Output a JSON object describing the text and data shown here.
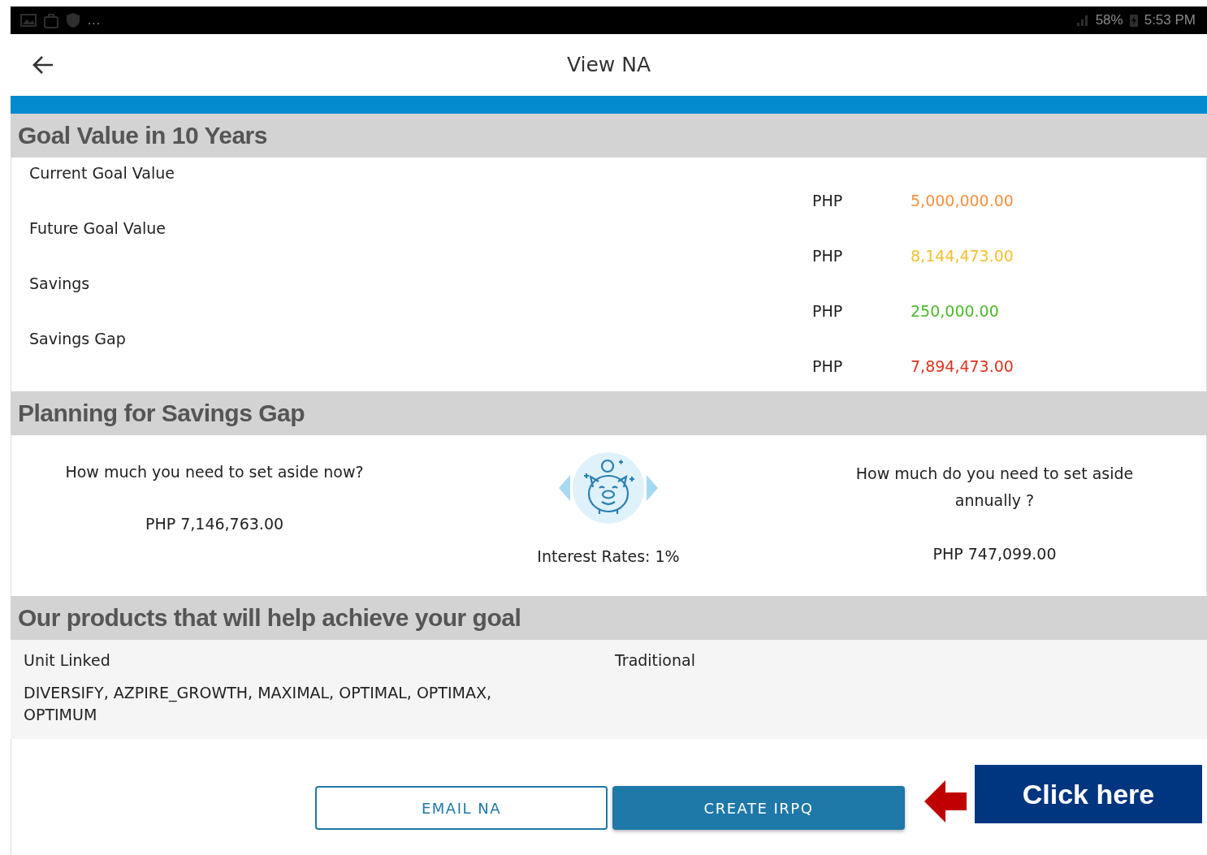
{
  "status_bar": {
    "overflow": "…",
    "battery": "58%",
    "time": "5:53 PM"
  },
  "header": {
    "title": "View NA"
  },
  "goal_section": {
    "title": "Goal Value in 10 Years",
    "rows": [
      {
        "label": "Current Goal Value",
        "currency": "PHP",
        "value": "5,000,000.00",
        "color": "#f7903f"
      },
      {
        "label": "Future Goal Value",
        "currency": "PHP",
        "value": "8,144,473.00",
        "color": "#f2c12e"
      },
      {
        "label": "Savings",
        "currency": "PHP",
        "value": "250,000.00",
        "color": "#4cb82a"
      },
      {
        "label": "Savings Gap",
        "currency": "PHP",
        "value": "7,894,473.00",
        "color": "#e0321e"
      }
    ]
  },
  "planning_section": {
    "title": "Planning for Savings Gap",
    "now_question": "How much you need to set aside now?",
    "now_amount": "PHP 7,146,763.00",
    "interest": "Interest Rates: 1%",
    "annual_question": "How much do you need to set aside annually ?",
    "annual_amount": "PHP 747,099.00"
  },
  "products_section": {
    "title": "Our products that will help achieve your goal",
    "columns": [
      {
        "heading": "Unit Linked",
        "products": "DIVERSIFY, AZPIRE_GROWTH, MAXIMAL, OPTIMAL, OPTIMAX, OPTIMUM"
      },
      {
        "heading": "Traditional"
      }
    ]
  },
  "actions": [
    {
      "label": "EMAIL NA",
      "kind": "outline"
    },
    {
      "label": "CREATE IRPQ",
      "kind": "filled"
    }
  ],
  "callout": {
    "label": "Click here"
  }
}
